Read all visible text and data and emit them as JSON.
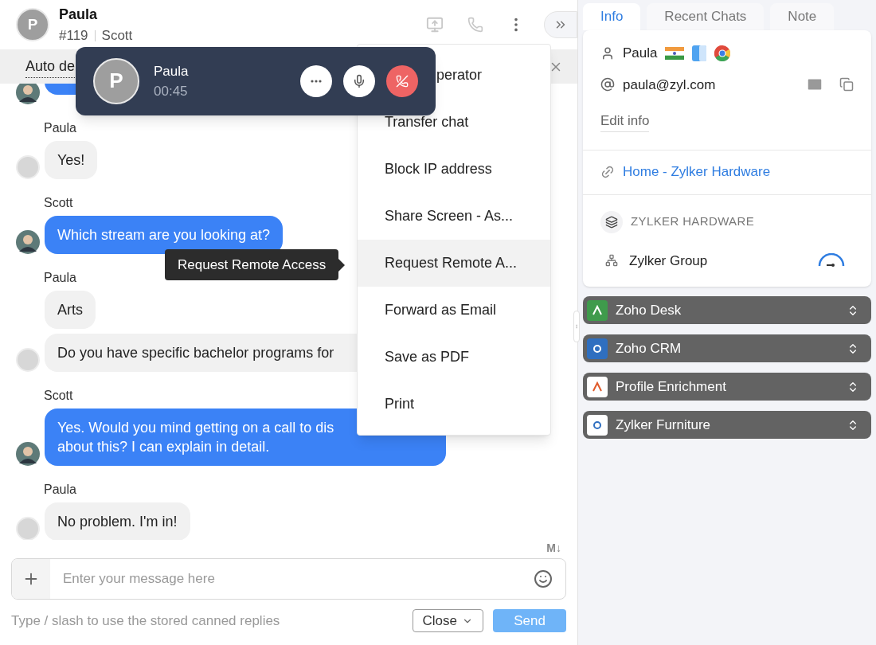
{
  "header": {
    "name": "Paula",
    "avatar_letter": "P",
    "ticket": "#119",
    "agent": "Scott"
  },
  "notice": {
    "text": "Auto de"
  },
  "groups": [
    {
      "sender": "Paula",
      "kind": "visitor",
      "bubbles": [
        [
          "Yes!"
        ]
      ]
    },
    {
      "sender": "Scott",
      "kind": "agent",
      "bubbles": [
        [
          "Which stream are you looking at?"
        ]
      ]
    },
    {
      "sender": "Paula",
      "kind": "visitor",
      "bubbles": [
        [
          "Arts"
        ],
        [
          "Do you have specific bachelor programs for"
        ]
      ]
    },
    {
      "sender": "Scott",
      "kind": "agent",
      "bubbles": [
        [
          "Yes. Would you mind getting on a call to dis",
          "about this? I can explain in detail."
        ]
      ]
    },
    {
      "sender": "Paula",
      "kind": "visitor",
      "bubbles": [
        [
          "No problem. I'm in!"
        ]
      ]
    }
  ],
  "call": {
    "name": "Paula",
    "avatar_letter": "P",
    "time": "00:45"
  },
  "menu": [
    {
      "text": "perator",
      "covered": true,
      "selected": false
    },
    {
      "text": "Transfer chat",
      "covered": false,
      "selected": false
    },
    {
      "text": "Block IP address",
      "covered": false,
      "selected": false
    },
    {
      "text": "Share Screen - As...",
      "covered": false,
      "selected": false
    },
    {
      "text": "Request Remote A...",
      "covered": false,
      "selected": true
    },
    {
      "text": "Forward as Email",
      "covered": false,
      "selected": false
    },
    {
      "text": "Save as PDF",
      "covered": false,
      "selected": false
    },
    {
      "text": "Print",
      "covered": false,
      "selected": false
    }
  ],
  "tooltip": "Request Remote Access",
  "composer": {
    "markdown": "M↓",
    "placeholder": "Enter your message here",
    "hint": "Type / slash to use the stored canned replies",
    "close": "Close",
    "send": "Send"
  },
  "tabs": [
    {
      "label": "Info",
      "selected": true
    },
    {
      "label": "Recent Chats",
      "selected": false
    },
    {
      "label": "Note",
      "selected": false
    }
  ],
  "contact": {
    "name": "Paula",
    "email": "paula@zyl.com",
    "edit": "Edit info"
  },
  "page_link": "Home - Zylker Hardware",
  "company": {
    "title": "ZYLKER HARDWARE",
    "group": "Zylker Group"
  },
  "integrations": [
    {
      "name": "Zoho Desk",
      "color": "#3f9b4c"
    },
    {
      "name": "Zoho CRM",
      "color": "#2f6fc0"
    },
    {
      "name": "Profile Enrichment",
      "color": "#ffffff"
    },
    {
      "name": "Zylker Furniture",
      "color": "#ffffff"
    }
  ]
}
